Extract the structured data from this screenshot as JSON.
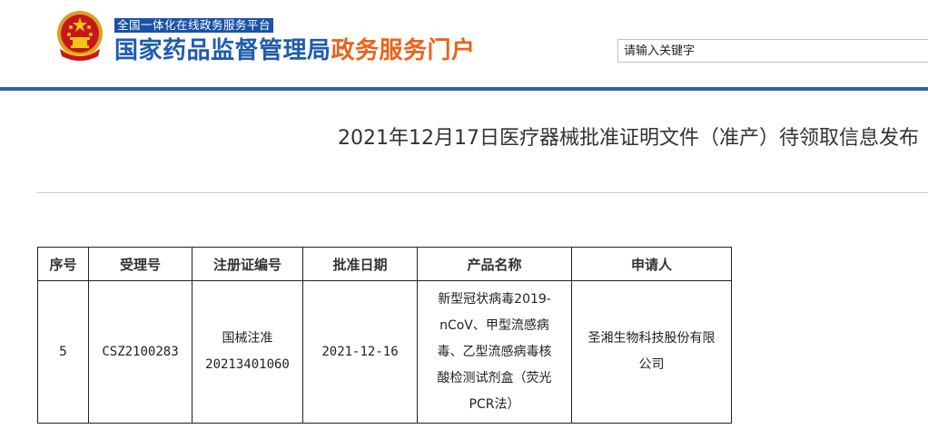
{
  "header": {
    "platform_tag": "全国一体化在线政务服务平台",
    "site_title_part1": "国家药品监督管理局",
    "site_title_part2": "政务服务门户",
    "search_value": "请输入关键字",
    "colors": {
      "brand_blue": "#1e5bb0",
      "brand_orange": "#e8641c",
      "rule_blue": "#2d62b2"
    },
    "emblem_icon": "national-emblem-icon"
  },
  "article": {
    "title": "2021年12月17日医疗器械批准证明文件（准产）待领取信息发布"
  },
  "table": {
    "headers": [
      "序号",
      "受理号",
      "注册证编号",
      "批准日期",
      "产品名称",
      "申请人"
    ],
    "rows": [
      {
        "index": "5",
        "acceptance_no": "CSZ2100283",
        "cert_no_line1": "国械注准",
        "cert_no_line2": "20213401060",
        "approval_date": "2021-12-16",
        "product_line1": "新型冠状病毒2019-",
        "product_line2": "nCoV、甲型流感病",
        "product_line3": "毒、乙型流感病毒核",
        "product_line4": "酸检测试剂盒（荧光",
        "product_line5": "PCR法）",
        "applicant_line1": "圣湘生物科技股份有限",
        "applicant_line2": "公司"
      }
    ]
  }
}
